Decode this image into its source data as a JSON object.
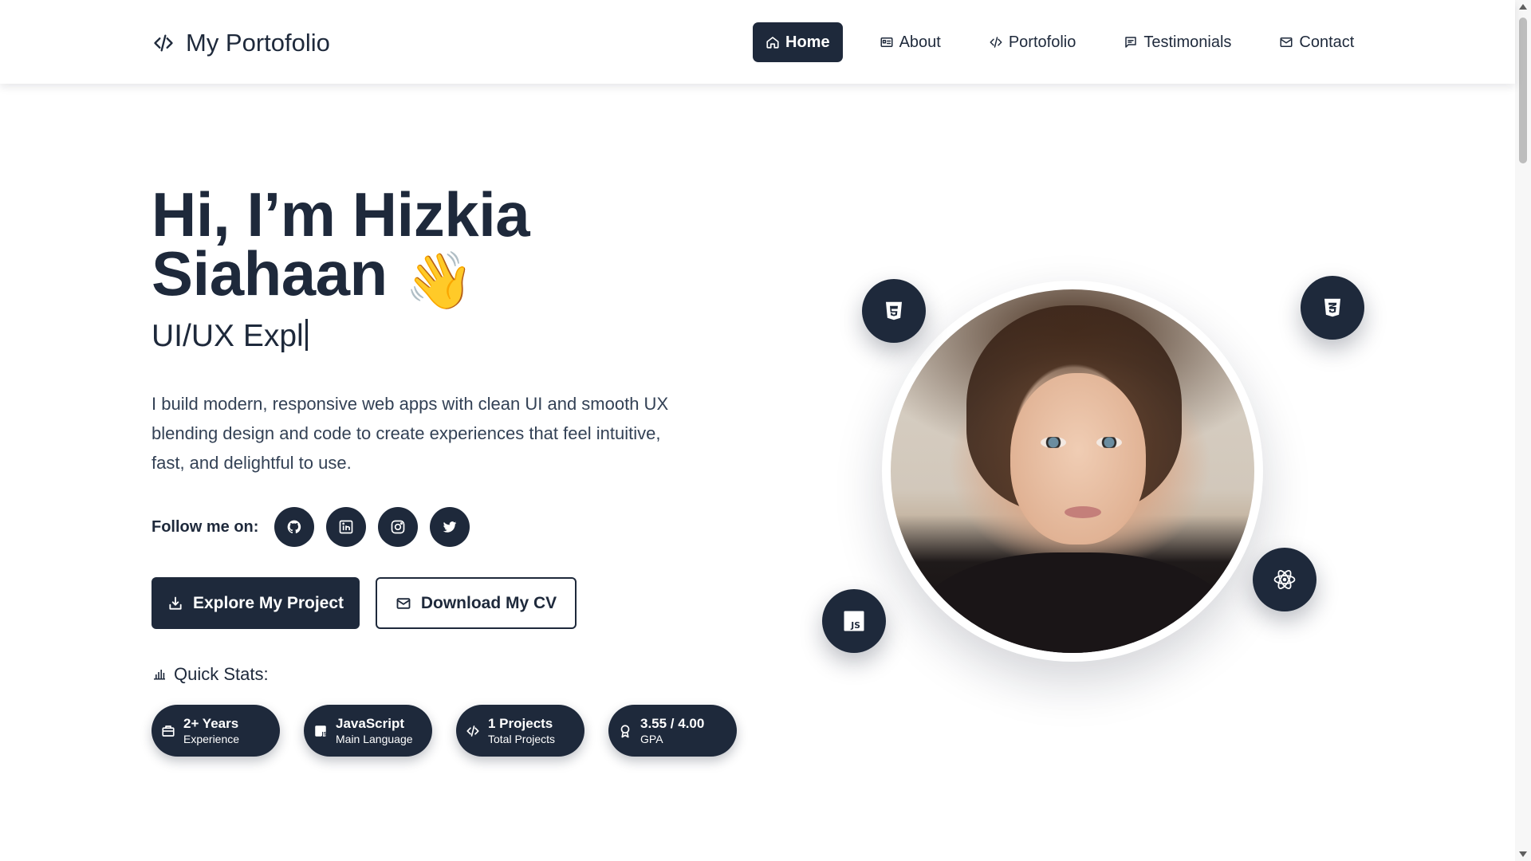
{
  "nav": {
    "brand": "My Portofolio",
    "brand_icon": "code-icon",
    "items": [
      {
        "label": "Home",
        "icon": "home-icon",
        "active": true
      },
      {
        "label": "About",
        "icon": "id-card-icon",
        "active": false
      },
      {
        "label": "Portofolio",
        "icon": "code-icon",
        "active": false
      },
      {
        "label": "Testimonials",
        "icon": "message-icon",
        "active": false
      },
      {
        "label": "Contact",
        "icon": "mail-icon",
        "active": false
      }
    ]
  },
  "hero": {
    "title_line1": "Hi, I’m Hizkia",
    "title_line2": "Siahaan",
    "wave_emoji": "👋",
    "typed_text": "UI/UX Expl",
    "description": "I build modern, responsive web apps with clean UI and smooth UX blending design and code to create experiences that feel intuitive, fast, and delightful to use.",
    "follow_label": "Follow me on:",
    "socials": [
      "github-icon",
      "linkedin-icon",
      "instagram-icon",
      "twitter-icon"
    ],
    "primary_button": "Explore My Project",
    "secondary_button": "Download My CV"
  },
  "stats": {
    "heading": "Quick Stats:",
    "items": [
      {
        "value": "2+ Years",
        "label": "Experience",
        "icon": "briefcase-icon"
      },
      {
        "value": "JavaScript",
        "label": "Main Language",
        "icon": "js-file-icon"
      },
      {
        "value": "1 Projects",
        "label": "Total Projects",
        "icon": "code-icon"
      },
      {
        "value": "3.55 / 4.00",
        "label": "GPA",
        "icon": "award-icon"
      }
    ]
  },
  "tech_badges": [
    "html5-icon",
    "css3-icon",
    "javascript-icon",
    "react-icon"
  ],
  "colors": {
    "primary": "#1e293b",
    "background": "#ffffff",
    "text_muted": "#334155"
  }
}
